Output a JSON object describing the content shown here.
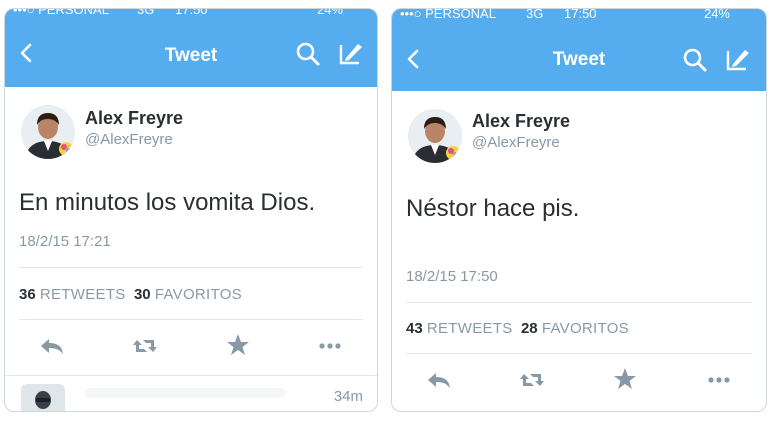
{
  "left": {
    "status": {
      "carrier": "•••○ PERSONAL",
      "network": "3G",
      "time": "17:50",
      "battery": "24%"
    },
    "nav": {
      "back_icon": "chevron-left-icon",
      "title": "Tweet",
      "search_icon": "search-icon",
      "compose_icon": "compose-icon"
    },
    "tweet": {
      "name": "Alex Freyre",
      "handle": "@AlexFreyre",
      "text": "En minutos los vomita Dios.",
      "date": "18/2/15 17:21",
      "retweets": "36",
      "retweets_label": "RETWEETS",
      "favorites": "30",
      "favorites_label": "FAVORITOS"
    },
    "actions": [
      "reply-icon",
      "retweet-icon",
      "favorite-star-icon",
      "more-icon"
    ],
    "next_item": {
      "time": "34m"
    }
  },
  "right": {
    "status": {
      "carrier": "•••○ PERSONAL",
      "network": "3G",
      "time": "17:50",
      "battery": "24%"
    },
    "nav": {
      "back_icon": "chevron-left-icon",
      "title": "Tweet",
      "search_icon": "search-icon",
      "compose_icon": "compose-icon"
    },
    "tweet": {
      "name": "Alex Freyre",
      "handle": "@AlexFreyre",
      "text": "Néstor hace pis.",
      "date": "18/2/15 17:50",
      "retweets": "43",
      "retweets_label": "RETWEETS",
      "favorites": "28",
      "favorites_label": "FAVORITOS"
    },
    "actions": [
      "reply-icon",
      "retweet-icon",
      "favorite-star-icon",
      "more-icon"
    ]
  },
  "colors": {
    "header": "#55acee",
    "text": "#292f33",
    "muted": "#8899a6",
    "divider": "#e1e8ed",
    "action_icon": "#aab8c2"
  }
}
